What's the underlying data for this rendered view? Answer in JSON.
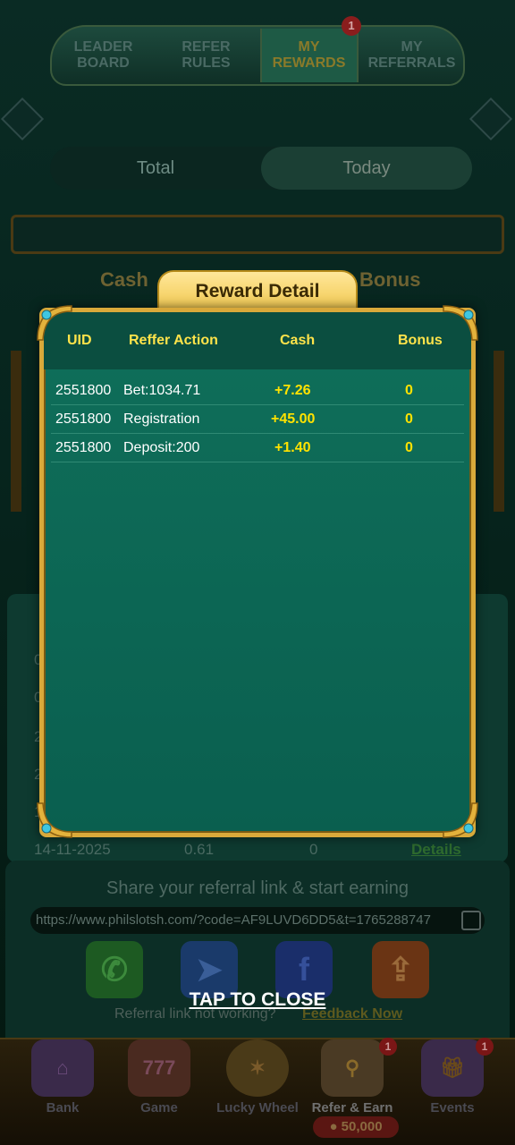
{
  "background": {
    "tabs": [
      "LEADER BOARD",
      "REFER RULES",
      "MY REWARDS",
      "MY REFERRALS"
    ],
    "active_tab": "MY REWARDS",
    "tab_badge": "1",
    "segments": [
      "Total",
      "Today"
    ],
    "stat_labels": {
      "cash": "Cash",
      "bonus": "Bonus"
    },
    "table_rows": [
      {
        "date": "0",
        "value": "",
        "bonus": ""
      },
      {
        "date": "0",
        "value": "",
        "bonus": ""
      },
      {
        "date": "2",
        "value": "",
        "bonus": ""
      },
      {
        "date": "2",
        "value": "",
        "bonus": ""
      },
      {
        "date": "1",
        "value": "",
        "bonus": ""
      }
    ],
    "last_row": {
      "date": "14-11-2025",
      "value": "0.61",
      "bonus": "0",
      "action": "Details"
    },
    "share": {
      "title": "Share your referral link & start earning",
      "link": "https://www.philslotsh.com/?code=AF9LUVD6DD5&t=1765288747",
      "not_working": "Referral link not working?",
      "feedback": "Feedback Now"
    },
    "nav": [
      {
        "label": "Bank",
        "icon": "bank-icon"
      },
      {
        "label": "Game",
        "icon": "slot-777-icon"
      },
      {
        "label": "Lucky Wheel",
        "icon": "wheel-icon"
      },
      {
        "label": "Refer & Earn",
        "icon": "share-icon",
        "badge": "1"
      },
      {
        "label": "Events",
        "icon": "gift-icon",
        "badge": "1"
      }
    ],
    "coin_amount": "50,000"
  },
  "modal": {
    "title": "Reward Detail",
    "headers": {
      "uid": "UID",
      "action": "Reffer Action",
      "cash": "Cash",
      "bonus": "Bonus"
    },
    "rows": [
      {
        "uid": "2551800",
        "action": "Bet:1034.71",
        "cash": "+7.26",
        "bonus": "0"
      },
      {
        "uid": "2551800",
        "action": "Registration",
        "cash": "+45.00",
        "bonus": "0"
      },
      {
        "uid": "2551800",
        "action": "Deposit:200",
        "cash": "+1.40",
        "bonus": "0"
      }
    ],
    "close_label": "TAP TO CLOSE"
  },
  "colors": {
    "modal_bg": "#0f6f5a",
    "gold_border": "#d9a93a",
    "header_yellow": "#ffe34a",
    "value_yellow": "#ffe200"
  }
}
